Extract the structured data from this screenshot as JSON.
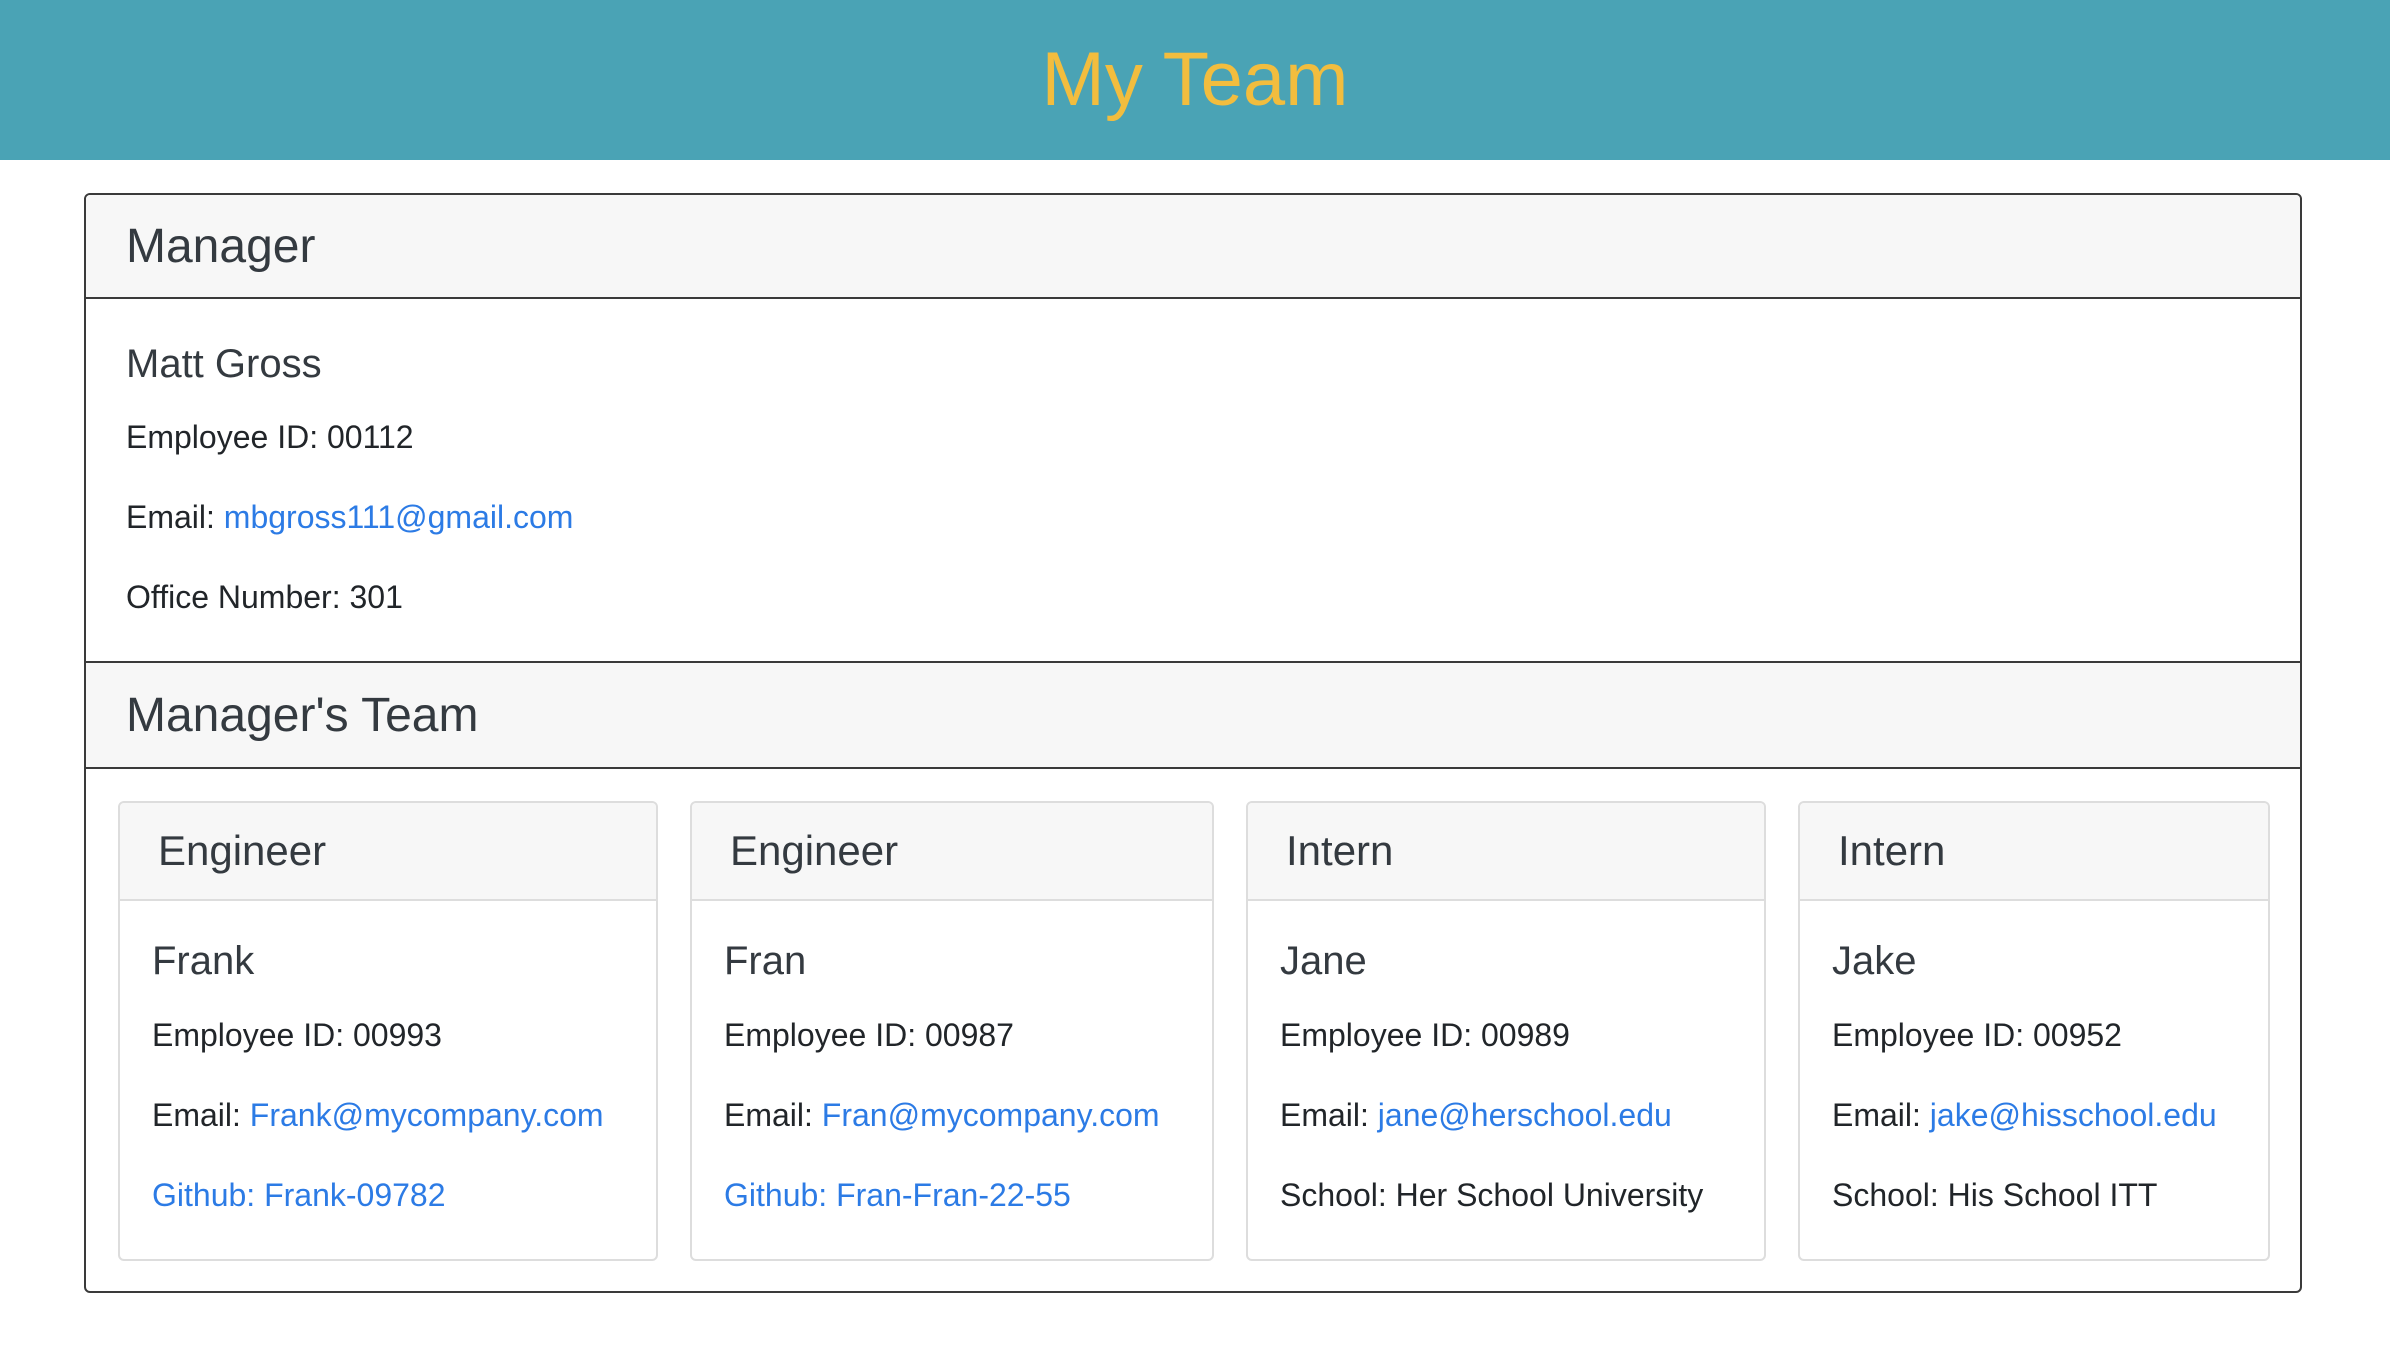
{
  "header": {
    "title": "My Team"
  },
  "manager_section": {
    "title": "Manager",
    "name": "Matt Gross",
    "id_label": "Employee ID:",
    "id_value": "00112",
    "email_label": "Email:",
    "email_value": "mbgross111@gmail.com",
    "office_label": "Office Number:",
    "office_value": "301"
  },
  "team_section": {
    "title": "Manager's Team",
    "members": [
      {
        "role": "Engineer",
        "name": "Frank",
        "id_text": "Employee ID: 00993",
        "email_label": "Email:",
        "email_value": "Frank@mycompany.com",
        "extra": "Github: Frank-09782"
      },
      {
        "role": "Engineer",
        "name": "Fran",
        "id_text": "Employee ID: 00987",
        "email_label": "Email:",
        "email_value": "Fran@mycompany.com",
        "extra": "Github: Fran-Fran-22-55"
      },
      {
        "role": "Intern",
        "name": "Jane",
        "id_text": "Employee ID: 00989",
        "email_label": "Email:",
        "email_value": "jane@herschool.edu",
        "extra": "School: Her School University"
      },
      {
        "role": "Intern",
        "name": "Jake",
        "id_text": "Employee ID: 00952",
        "email_label": "Email:",
        "email_value": "jake@hisschool.edu",
        "extra": "School: His School ITT"
      }
    ]
  },
  "colors": {
    "banner": "#4aa3b5",
    "title": "#f2bd3e",
    "link": "#2c7be5"
  }
}
